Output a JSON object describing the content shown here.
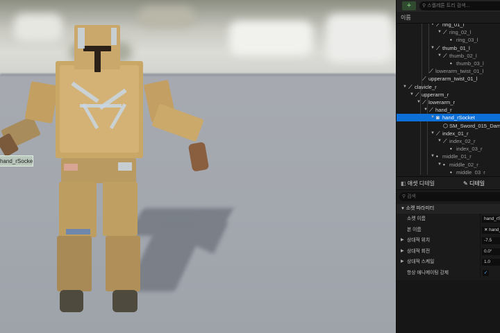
{
  "panel": {
    "add_label": "+",
    "search_placeholder": "스켈레톤 트리 검색...",
    "column_header": "이름",
    "tree": [
      {
        "label": "ring_01_l",
        "icon": "bone-icon",
        "level": 5,
        "expanded": true,
        "style": "normal"
      },
      {
        "label": "ring_02_l",
        "icon": "bone-icon",
        "level": 6,
        "expanded": true,
        "style": "dim"
      },
      {
        "label": "ring_03_l",
        "icon": "dot-icon",
        "level": 7,
        "expanded": false,
        "style": "dim"
      },
      {
        "label": "thumb_01_l",
        "icon": "bone-icon",
        "level": 5,
        "expanded": true,
        "style": "normal"
      },
      {
        "label": "thumb_02_l",
        "icon": "bone-icon",
        "level": 6,
        "expanded": true,
        "style": "dim"
      },
      {
        "label": "thumb_03_l",
        "icon": "dot-icon",
        "level": 7,
        "expanded": false,
        "style": "dim"
      },
      {
        "label": "lowerarm_twist_01_l",
        "icon": "bone-icon",
        "level": 4,
        "expanded": false,
        "style": "dim"
      },
      {
        "label": "upperarm_twist_01_l",
        "icon": "bone-icon",
        "level": 3,
        "expanded": false,
        "style": "normal"
      },
      {
        "label": "clavicle_r",
        "icon": "bone-icon",
        "level": 1,
        "expanded": true,
        "style": "normal"
      },
      {
        "label": "upperarm_r",
        "icon": "bone-icon",
        "level": 2,
        "expanded": true,
        "style": "normal"
      },
      {
        "label": "lowerarm_r",
        "icon": "bone-icon",
        "level": 3,
        "expanded": true,
        "style": "normal"
      },
      {
        "label": "hand_r",
        "icon": "bone-icon",
        "level": 4,
        "expanded": true,
        "style": "normal"
      },
      {
        "label": "hand_rSocket",
        "icon": "socket-icon",
        "level": 5,
        "expanded": true,
        "style": "selected"
      },
      {
        "label": "SM_Sword_015_Dam",
        "icon": "mesh-icon",
        "level": 6,
        "expanded": false,
        "style": "normal"
      },
      {
        "label": "index_01_r",
        "icon": "bone-icon",
        "level": 5,
        "expanded": true,
        "style": "normal"
      },
      {
        "label": "index_02_r",
        "icon": "bone-icon",
        "level": 6,
        "expanded": true,
        "style": "dim"
      },
      {
        "label": "index_03_r",
        "icon": "dot-icon",
        "level": 7,
        "expanded": false,
        "style": "dim"
      },
      {
        "label": "middle_01_r",
        "icon": "dot-icon",
        "level": 5,
        "expanded": true,
        "style": "dim"
      },
      {
        "label": "middle_02_r",
        "icon": "dot-icon",
        "level": 6,
        "expanded": true,
        "style": "dim"
      },
      {
        "label": "middle_03_r",
        "icon": "dot-icon",
        "level": 7,
        "expanded": false,
        "style": "dim"
      }
    ],
    "tabs": {
      "asset_details": "애셋 디테일",
      "details": "디테일",
      "asset_icon": "asset-details-icon",
      "details_icon": "pencil-icon"
    },
    "details_search_placeholder": "검색",
    "category": "소켓 파라미터",
    "props": [
      {
        "label": "소켓 이름",
        "value": "hand_rSocket",
        "expandable": false,
        "kind": "text"
      },
      {
        "label": "본 이름",
        "value": "hand_r",
        "expandable": false,
        "kind": "bone"
      },
      {
        "label": "상대적 위치",
        "value": "-7.5",
        "expandable": true,
        "kind": "text"
      },
      {
        "label": "상대적 회전",
        "value": "0.0°",
        "expandable": true,
        "kind": "text"
      },
      {
        "label": "상대적 스케일",
        "value": "1.0",
        "expandable": true,
        "kind": "text"
      },
      {
        "label": "항상 애니메이팅 강제",
        "value": "✓",
        "expandable": false,
        "kind": "check"
      }
    ]
  },
  "viewport": {
    "socket_label": "hand_rSocket"
  },
  "colors": {
    "selection": "#0d6fd8",
    "panel_bg": "#1a1a1a",
    "viewport_floor": "#a3a7ae",
    "cardboard": "#c8a56a"
  }
}
